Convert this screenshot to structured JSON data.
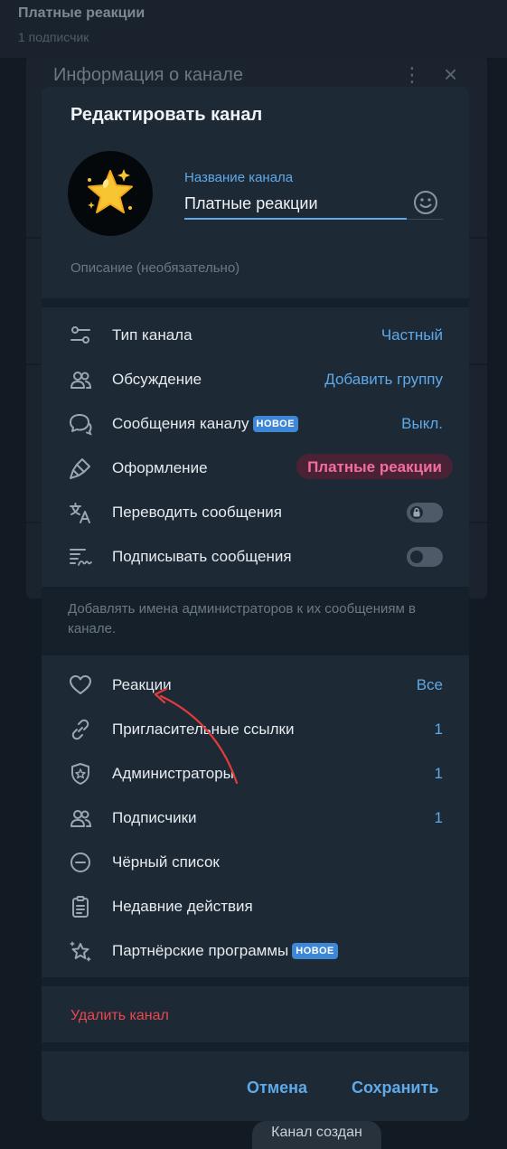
{
  "background": {
    "chat_title": "Платные реакции",
    "chat_subtitle": "1 подписчик",
    "panel_title": "Информация о канале"
  },
  "dialog": {
    "title": "Редактировать канал",
    "name_label": "Название канала",
    "name_value": "Платные реакции",
    "description_placeholder": "Описание (необязательно)"
  },
  "settings": {
    "channel_type": {
      "label": "Тип канала",
      "value": "Частный"
    },
    "discussion": {
      "label": "Обсуждение",
      "value": "Добавить группу"
    },
    "channel_messages": {
      "label": "Сообщения каналу",
      "badge": "НОВОЕ",
      "value": "Выкл."
    },
    "appearance": {
      "label": "Оформление",
      "value": "Платные реакции"
    },
    "translate": {
      "label": "Переводить сообщения",
      "enabled": false,
      "locked": true
    },
    "sign": {
      "label": "Подписывать сообщения",
      "enabled": false
    }
  },
  "sign_hint": "Добавлять имена администраторов к их сообщениям в канале.",
  "management": {
    "reactions": {
      "label": "Реакции",
      "value": "Все"
    },
    "invite_links": {
      "label": "Пригласительные ссылки",
      "value": "1"
    },
    "admins": {
      "label": "Администраторы",
      "value": "1"
    },
    "subscribers": {
      "label": "Подписчики",
      "value": "1"
    },
    "blacklist": {
      "label": "Чёрный список"
    },
    "recent_actions": {
      "label": "Недавние действия"
    },
    "affiliate": {
      "label": "Партнёрские программы",
      "badge": "НОВОЕ"
    }
  },
  "delete_label": "Удалить канал",
  "footer": {
    "cancel": "Отмена",
    "save": "Сохранить"
  },
  "toast": "Канал создан",
  "colors": {
    "accent": "#5ea9e8",
    "danger": "#e8484f",
    "pink": "#f26da0",
    "badge": "#3e86d6"
  }
}
